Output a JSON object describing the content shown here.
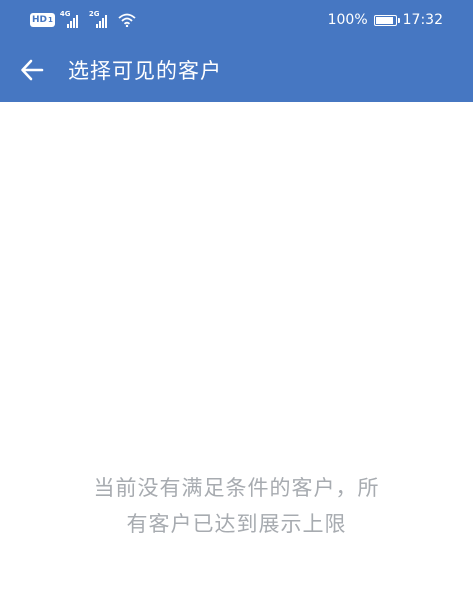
{
  "theme": {
    "accent": "#4677c2",
    "empty_text_color": "#a7abb0"
  },
  "status_bar": {
    "hd_label": "HD",
    "hd_sub": "1",
    "sim1_network": "4G",
    "sim2_network": "2G",
    "battery_percent_text": "100%",
    "battery_level": 1.0,
    "time": "17:32",
    "icons": [
      "hd-volte-icon",
      "signal-icon",
      "signal-icon",
      "wifi-icon",
      "battery-icon"
    ]
  },
  "header": {
    "back_icon": "arrow-left-icon",
    "title": "选择可见的客户"
  },
  "main": {
    "empty_line_1": "当前没有满足条件的客户，所",
    "empty_line_2": "有客户已达到展示上限"
  }
}
